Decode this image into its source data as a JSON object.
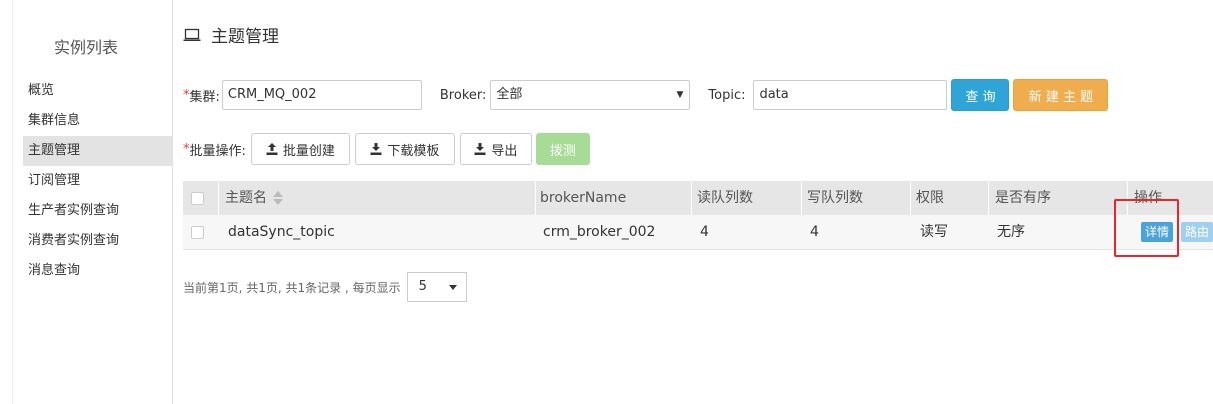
{
  "sidebar": {
    "title": "实例列表",
    "items": [
      {
        "label": "概览"
      },
      {
        "label": "集群信息"
      },
      {
        "label": "主题管理"
      },
      {
        "label": "订阅管理"
      },
      {
        "label": "生产者实例查询"
      },
      {
        "label": "消费者实例查询"
      },
      {
        "label": "消息查询"
      }
    ],
    "active_index": 2
  },
  "header": {
    "title": "主题管理",
    "icon": "laptop-icon"
  },
  "filters": {
    "required_mark": "*",
    "cluster_label": "集群:",
    "cluster_value": "CRM_MQ_002",
    "broker_label": "Broker:",
    "broker_value": "全部",
    "topic_label": "Topic:",
    "topic_value": "data",
    "query_button": "查 询",
    "create_button": "新 建 主 题"
  },
  "batch": {
    "label": "批量操作:",
    "batch_create": "批量创建",
    "download_template": "下载模板",
    "export": "导出",
    "probe": "拨测"
  },
  "table": {
    "columns": [
      "主题名",
      "brokerName",
      "读队列数",
      "写队列数",
      "权限",
      "是否有序",
      "操作"
    ],
    "rows": [
      {
        "topic": "dataSync_topic",
        "broker": "crm_broker_002",
        "read_queues": "4",
        "write_queues": "4",
        "perm": "读写",
        "ordered": "无序",
        "actions": [
          "详情",
          "路由"
        ]
      }
    ]
  },
  "pagination": {
    "summary": "当前第1页, 共1页, 共1条记录 , 每页显示",
    "page_size": "5"
  },
  "colors": {
    "accent_info": "#2fa4d7",
    "accent_warn": "#f0ad4e",
    "success_disabled": "#a6dc95",
    "highlight": "#e8262b"
  }
}
